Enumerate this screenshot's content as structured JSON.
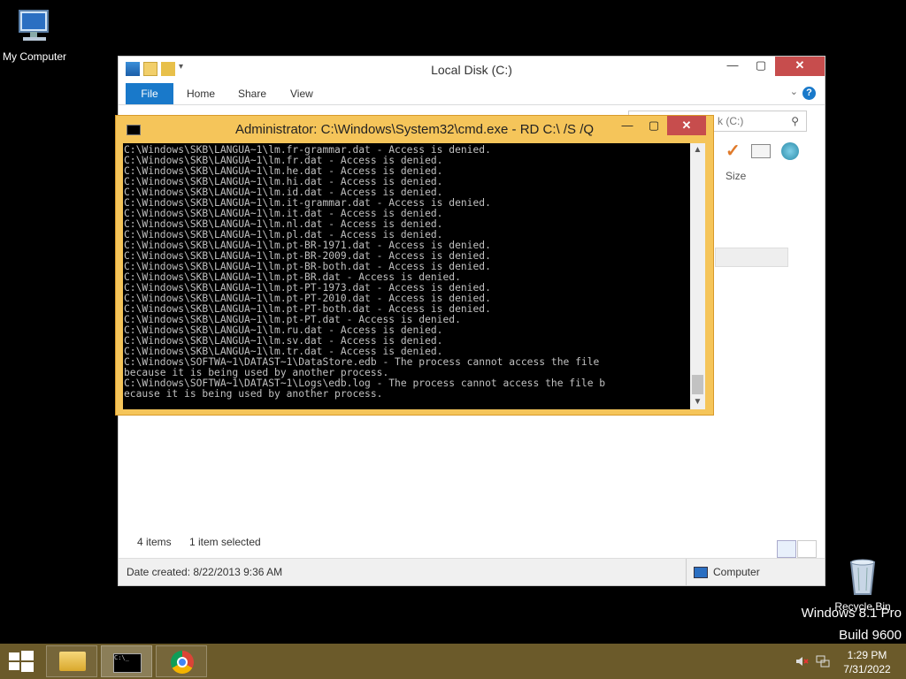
{
  "desktop": {
    "icons": [
      {
        "label": "My Computer",
        "icon": "monitor-icon"
      },
      {
        "label": "Recycle Bin",
        "icon": "recycle-bin-icon"
      }
    ],
    "watermark": {
      "edition": "Windows 8.1 Pro",
      "build": "Build 9600"
    }
  },
  "explorer": {
    "title": "Local Disk (C:)",
    "ribbon_tabs": [
      "File",
      "Home",
      "Share",
      "View"
    ],
    "search_placeholder": "k (C:)",
    "column_size": "Size",
    "status": {
      "items": "4 items",
      "selected": "1 item selected"
    },
    "details": {
      "date_created": "Date created: 8/22/2013 9:36 AM",
      "location": "Computer"
    }
  },
  "cmd": {
    "title": "Administrator: C:\\Windows\\System32\\cmd.exe - RD  C:\\ /S /Q",
    "lines": [
      "C:\\Windows\\SKB\\LANGUA~1\\lm.fr-grammar.dat - Access is denied.",
      "C:\\Windows\\SKB\\LANGUA~1\\lm.fr.dat - Access is denied.",
      "C:\\Windows\\SKB\\LANGUA~1\\lm.he.dat - Access is denied.",
      "C:\\Windows\\SKB\\LANGUA~1\\lm.hi.dat - Access is denied.",
      "C:\\Windows\\SKB\\LANGUA~1\\lm.id.dat - Access is denied.",
      "C:\\Windows\\SKB\\LANGUA~1\\lm.it-grammar.dat - Access is denied.",
      "C:\\Windows\\SKB\\LANGUA~1\\lm.it.dat - Access is denied.",
      "C:\\Windows\\SKB\\LANGUA~1\\lm.nl.dat - Access is denied.",
      "C:\\Windows\\SKB\\LANGUA~1\\lm.pl.dat - Access is denied.",
      "C:\\Windows\\SKB\\LANGUA~1\\lm.pt-BR-1971.dat - Access is denied.",
      "C:\\Windows\\SKB\\LANGUA~1\\lm.pt-BR-2009.dat - Access is denied.",
      "C:\\Windows\\SKB\\LANGUA~1\\lm.pt-BR-both.dat - Access is denied.",
      "C:\\Windows\\SKB\\LANGUA~1\\lm.pt-BR.dat - Access is denied.",
      "C:\\Windows\\SKB\\LANGUA~1\\lm.pt-PT-1973.dat - Access is denied.",
      "C:\\Windows\\SKB\\LANGUA~1\\lm.pt-PT-2010.dat - Access is denied.",
      "C:\\Windows\\SKB\\LANGUA~1\\lm.pt-PT-both.dat - Access is denied.",
      "C:\\Windows\\SKB\\LANGUA~1\\lm.pt-PT.dat - Access is denied.",
      "C:\\Windows\\SKB\\LANGUA~1\\lm.ru.dat - Access is denied.",
      "C:\\Windows\\SKB\\LANGUA~1\\lm.sv.dat - Access is denied.",
      "C:\\Windows\\SKB\\LANGUA~1\\lm.tr.dat - Access is denied.",
      "C:\\Windows\\SOFTWA~1\\DATAST~1\\DataStore.edb - The process cannot access the file",
      "because it is being used by another process.",
      "C:\\Windows\\SOFTWA~1\\DATAST~1\\Logs\\edb.log - The process cannot access the file b",
      "ecause it is being used by another process."
    ]
  },
  "taskbar": {
    "apps": [
      {
        "name": "File Explorer",
        "icon": "folder-icon"
      },
      {
        "name": "Command Prompt",
        "icon": "cmd-icon"
      },
      {
        "name": "Google Chrome",
        "icon": "chrome-icon"
      }
    ],
    "clock": {
      "time": "1:29 PM",
      "date": "7/31/2022"
    }
  },
  "colors": {
    "cmd_frame": "#f5c55a",
    "taskbar": "#6b5a2a",
    "file_tab": "#1979ca",
    "close": "#c74d4d"
  }
}
